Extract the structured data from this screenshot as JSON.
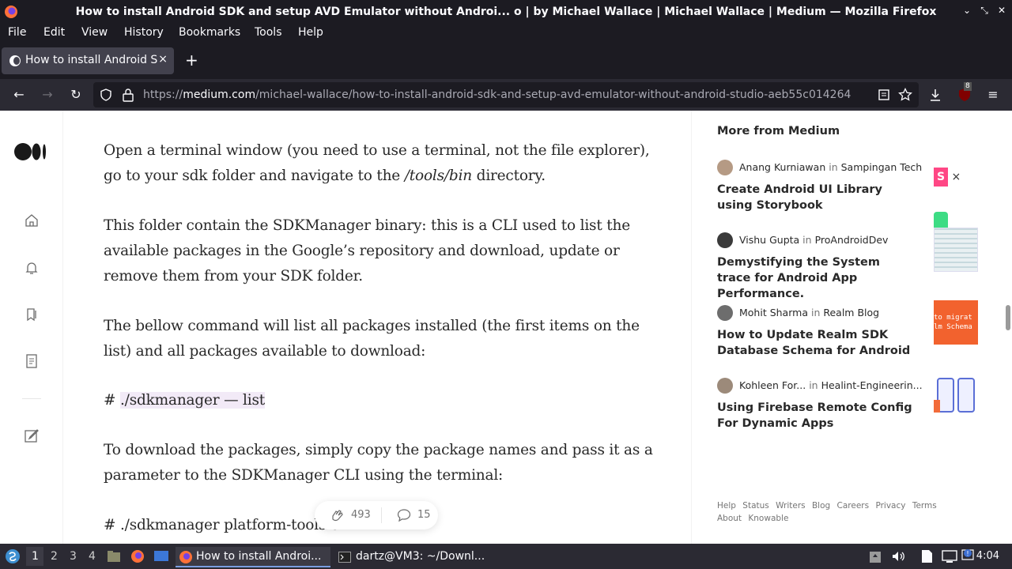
{
  "window": {
    "title": "How to install Android SDK and setup AVD Emulator without Androi...  o | by Michael Wallace | Michael Wallace | Medium — Mozilla Firefox",
    "controls": [
      "minimize-icon",
      "restore-icon",
      "close-icon"
    ]
  },
  "menu": [
    "File",
    "Edit",
    "View",
    "History",
    "Bookmarks",
    "Tools",
    "Help"
  ],
  "tab": {
    "label": "How to install Android SDK",
    "close": "×",
    "new": "+"
  },
  "nav": {
    "url_prefix": "https://",
    "url_host": "medium.com",
    "url_path": "/michael-wallace/how-to-install-android-sdk-and-setup-avd-emulator-without-android-studio-aeb55c014264",
    "extension_badge": "8"
  },
  "article": {
    "p1_a": "Open a terminal window (you need to use a terminal, not the file explorer), go to your sdk folder and navigate to the ",
    "p1_em": "/tools/bin",
    "p1_b": " directory.",
    "p2": "This folder contain the SDKManager binary: this is a CLI used to list the available packages in the Google’s repository and download, update or remove them from your SDK folder.",
    "p3": "The bellow command will list all packages installed (the first items on the list) and all packages available to download:",
    "p4_prefix": "# ",
    "p4_code": "./sdkmanager — list",
    "p5": "To download the packages, simply copy the package names and pass it as a parameter to the SDKManager CLI using the terminal:",
    "p6": "# ./sdkmanager platform-tools e"
  },
  "claps": {
    "count": "493",
    "comments": "15"
  },
  "sidebar": {
    "heading": "More from Medium",
    "in_word": "in",
    "stories": [
      {
        "author": "Anang Kurniawan",
        "publication": "Sampingan Tech",
        "headline": "Create Android UI Library using Storybook",
        "thumb_text": "S × "
      },
      {
        "author": "Vishu Gupta",
        "publication": "ProAndroidDev",
        "headline": "Demystifying the System trace for Android App Performance.",
        "thumb_text": ""
      },
      {
        "author": "Mohit Sharma",
        "publication": "Realm Blog",
        "headline": "How to Update Realm SDK Database Schema for Android",
        "thumb_text": "to migrat lm Schema"
      },
      {
        "author": "Kohleen For...",
        "publication": "Healint-Engineerin...",
        "headline": "Using Firebase Remote Config For Dynamic Apps",
        "thumb_text": ""
      }
    ],
    "footer": [
      "Help",
      "Status",
      "Writers",
      "Blog",
      "Careers",
      "Privacy",
      "Terms",
      "About",
      "Knowable"
    ]
  },
  "taskbar": {
    "workspaces": [
      "1",
      "2",
      "3",
      "4"
    ],
    "tasks": [
      "How to install Androi...",
      "dartz@VM3: ~/Downl..."
    ],
    "clock": "4:04"
  }
}
